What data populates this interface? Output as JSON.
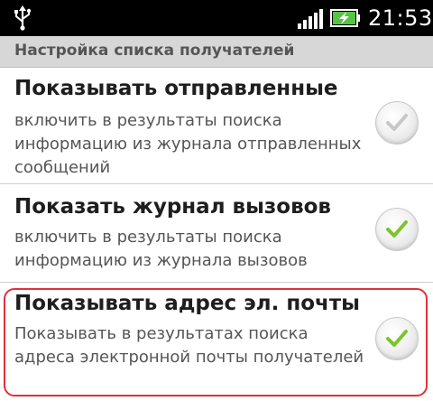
{
  "status_bar": {
    "time": "21:53",
    "icons": [
      "usb-icon",
      "signal-strength-icon",
      "battery-charging-icon"
    ],
    "battery_color": "#57c441"
  },
  "section": {
    "title": "Настройка списка получателей"
  },
  "settings": [
    {
      "title": "Показывать отправленные",
      "description": "включить в результаты поиска информацию из журнала отправленных сообщений",
      "checked": false
    },
    {
      "title": "Показать журнал вызовов",
      "description": "включить в результаты поиска информацию из журнала вызовов",
      "checked": true
    },
    {
      "title": "Показывать адрес эл. почты",
      "description": "Показывать в результатах поиска адреса электронной почты получателей",
      "checked": true
    }
  ],
  "colors": {
    "check_on": "#7cc42b",
    "check_off": "#c7c7c7",
    "highlight": "#e0313a"
  }
}
